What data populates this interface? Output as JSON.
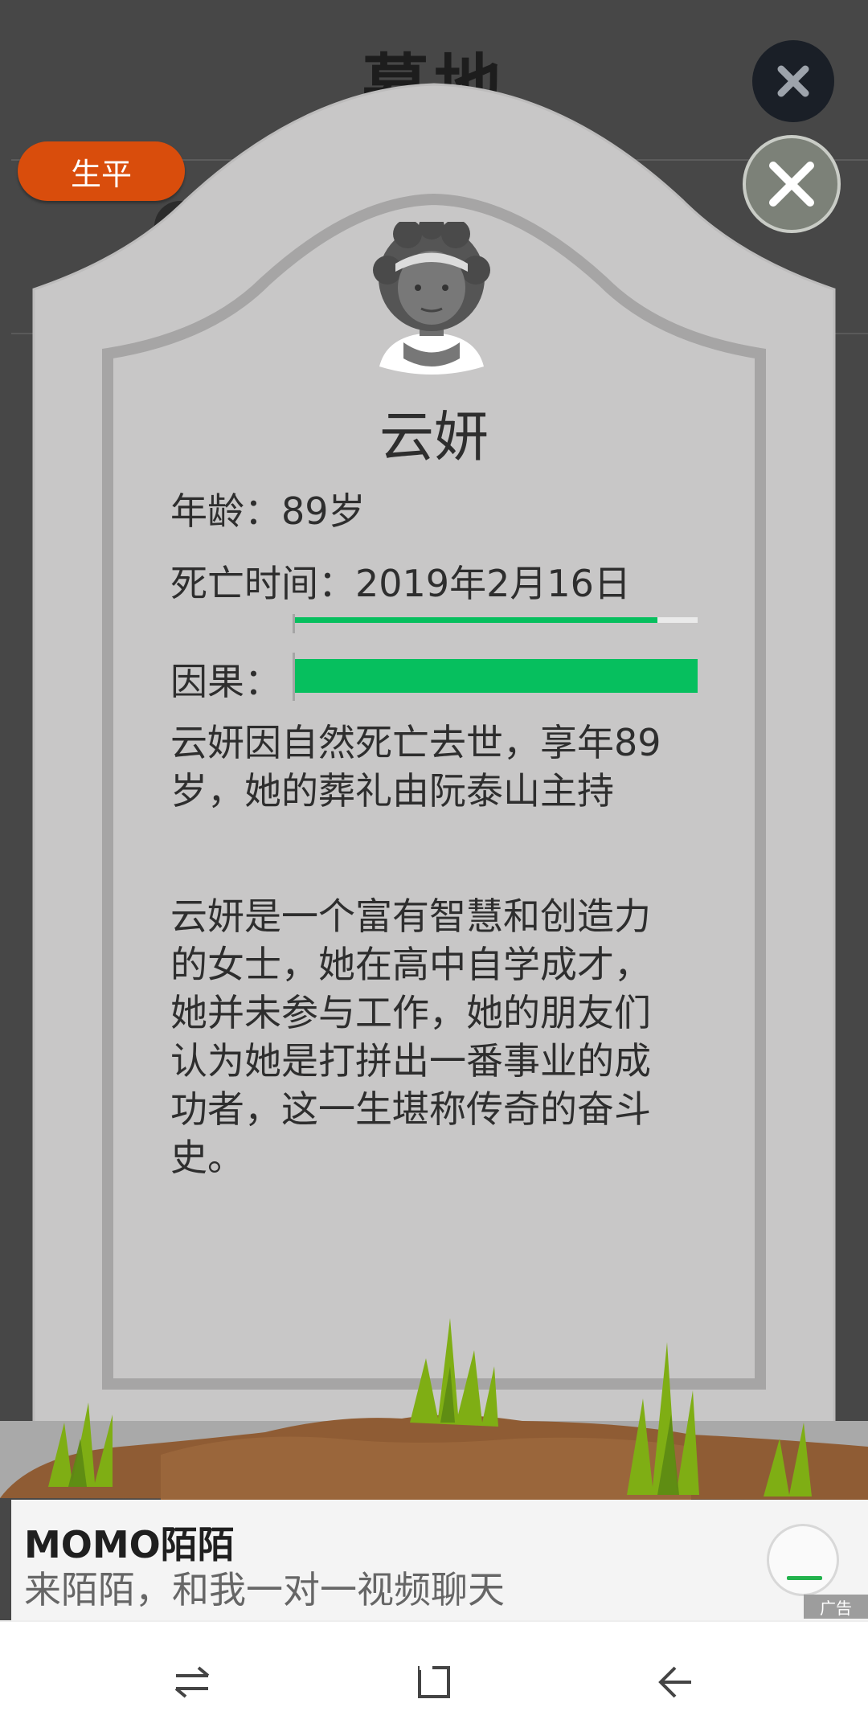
{
  "background": {
    "title": "墓地"
  },
  "bio_tag": "生平",
  "person": {
    "name": "云妍",
    "age_label": "年龄：89岁",
    "death_label": "死亡时间：2019年2月16日",
    "karma_label": "因果：",
    "hidden_bar_progress": 0.9,
    "karma_progress": 1.0
  },
  "paragraphs": {
    "p1": "云妍因自然死亡去世，享年89岁，她的葬礼由阮泰山主持",
    "p2": "云妍是一个富有智慧和创造力的女士，她在高中自学成才，她并未参与工作，她的朋友们认为她是打拼出一番事业的成功者，这一生堪称传奇的奋斗史。"
  },
  "ad": {
    "title": "MOMO陌陌",
    "subtitle": "来陌陌，和我一对一视频聊天",
    "tag": "广告"
  },
  "colors": {
    "bio_tag": "#d94d0c",
    "progress": "#06bf5e",
    "tomb": "#c8c7c7"
  },
  "icons": {
    "close": "close-icon",
    "nav_switch": "switch-icon",
    "nav_home": "home-icon",
    "nav_back": "back-icon"
  }
}
